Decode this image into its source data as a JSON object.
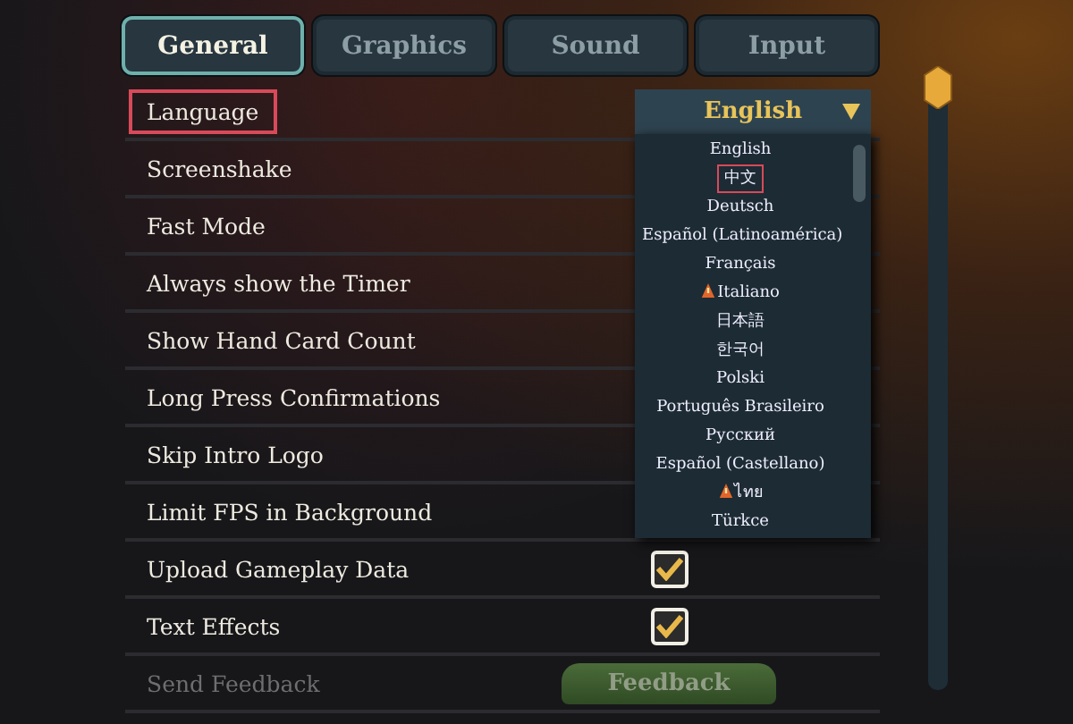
{
  "tabs": [
    {
      "label": "General",
      "selected": true
    },
    {
      "label": "Graphics",
      "selected": false
    },
    {
      "label": "Sound",
      "selected": false
    },
    {
      "label": "Input",
      "selected": false
    }
  ],
  "settings": [
    {
      "label": "Language",
      "highlighted": true,
      "kind": "dropdown"
    },
    {
      "label": "Screenshake",
      "highlighted": false,
      "kind": "hidden"
    },
    {
      "label": "Fast Mode",
      "highlighted": false,
      "kind": "hidden"
    },
    {
      "label": "Always show the Timer",
      "highlighted": false,
      "kind": "hidden"
    },
    {
      "label": "Show Hand Card Count",
      "highlighted": false,
      "kind": "hidden"
    },
    {
      "label": "Long Press Confirmations",
      "highlighted": false,
      "kind": "hidden"
    },
    {
      "label": "Skip Intro Logo",
      "highlighted": false,
      "kind": "hidden"
    },
    {
      "label": "Limit FPS in Background",
      "highlighted": false,
      "kind": "hidden"
    },
    {
      "label": "Upload Gameplay Data",
      "highlighted": false,
      "kind": "checkbox",
      "checked": true
    },
    {
      "label": "Text Effects",
      "highlighted": false,
      "kind": "checkbox",
      "checked": true
    },
    {
      "label": "Send Feedback",
      "highlighted": false,
      "kind": "button",
      "button": "Feedback",
      "disabled": true
    }
  ],
  "language_dropdown": {
    "value": "English",
    "expanded": true,
    "options": [
      {
        "label": "English",
        "highlighted": false,
        "warning": false
      },
      {
        "label": "中文",
        "highlighted": true,
        "warning": false
      },
      {
        "label": "Deutsch",
        "highlighted": false,
        "warning": false
      },
      {
        "label": "Español (Latinoamérica)",
        "highlighted": false,
        "warning": false
      },
      {
        "label": "Français",
        "highlighted": false,
        "warning": false
      },
      {
        "label": "Italiano",
        "highlighted": false,
        "warning": true
      },
      {
        "label": "日本語",
        "highlighted": false,
        "warning": false
      },
      {
        "label": "한국어",
        "highlighted": false,
        "warning": false
      },
      {
        "label": "Polski",
        "highlighted": false,
        "warning": false
      },
      {
        "label": "Português Brasileiro",
        "highlighted": false,
        "warning": false
      },
      {
        "label": "Русский",
        "highlighted": false,
        "warning": false
      },
      {
        "label": "Español (Castellano)",
        "highlighted": false,
        "warning": false
      },
      {
        "label": "ไทย",
        "highlighted": false,
        "warning": true
      },
      {
        "label": "Türkce",
        "highlighted": false,
        "warning": false
      }
    ]
  }
}
